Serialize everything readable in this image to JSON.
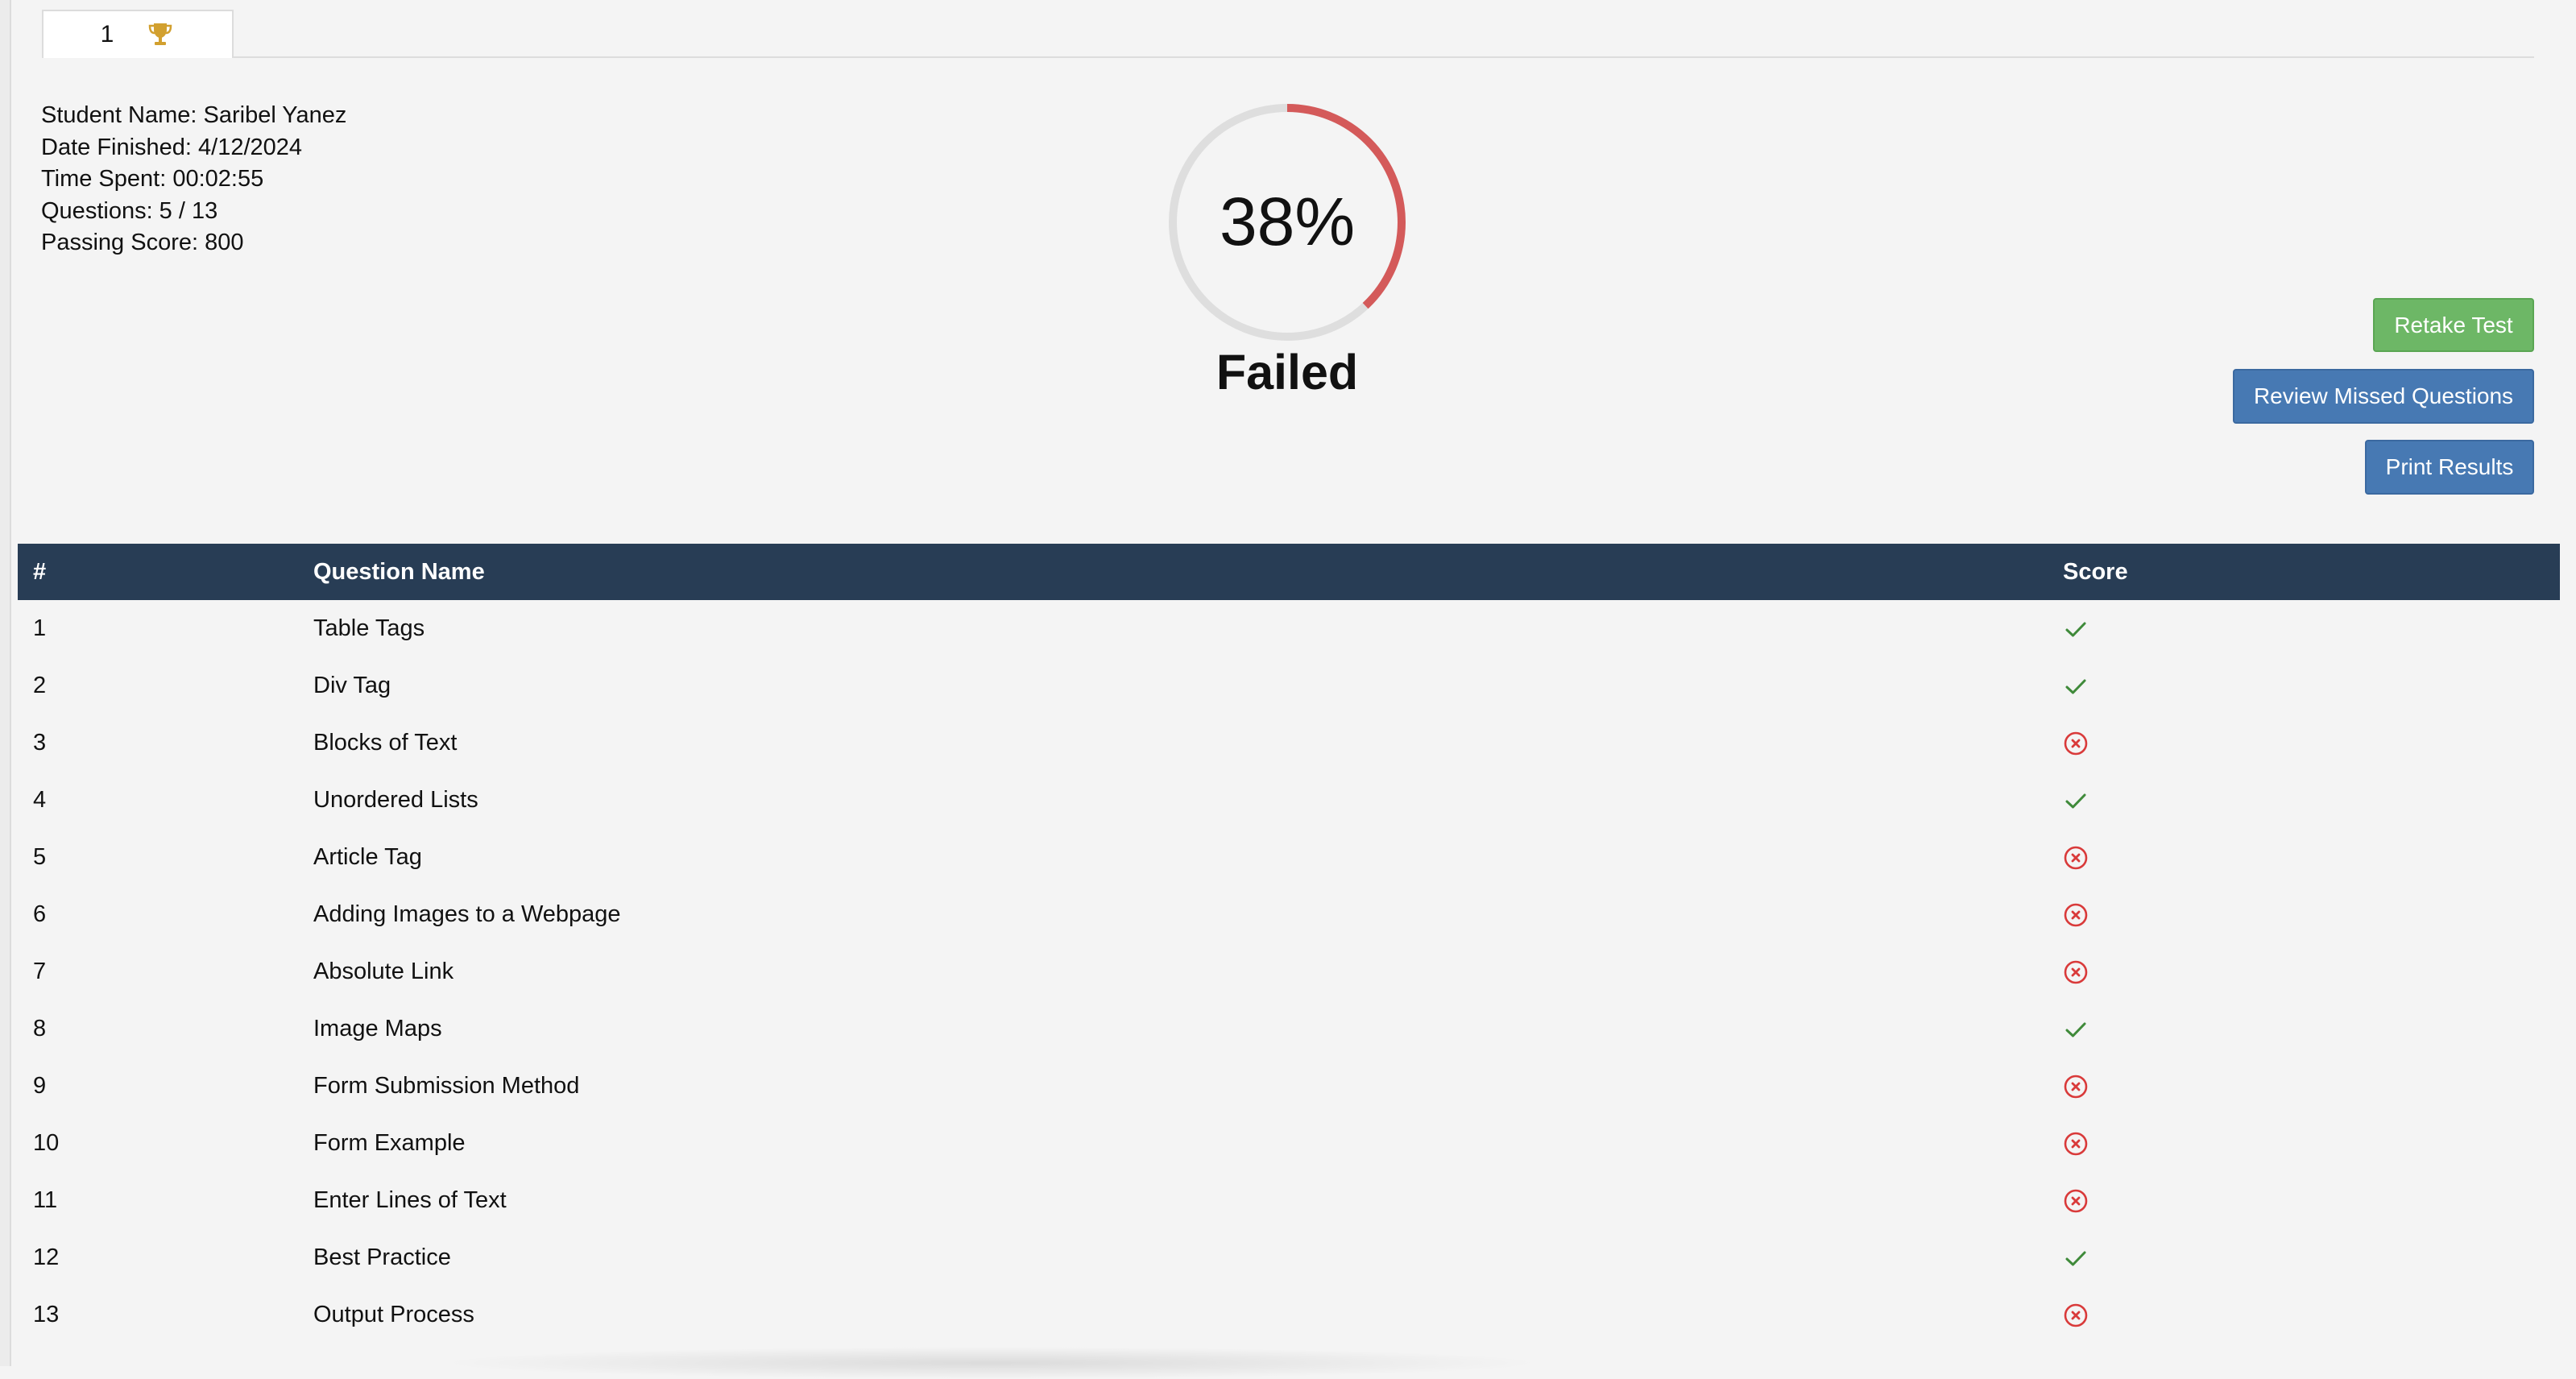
{
  "tab": {
    "label": "1",
    "icon": "trophy-icon",
    "icon_color": "#d2a02f"
  },
  "info": {
    "student_name": "Student Name: Saribel Yanez",
    "date_finished": "Date Finished: 4/12/2024",
    "time_spent": "Time Spent: 00:02:55",
    "questions": "Questions: 5 / 13",
    "passing_score": "Passing Score: 800"
  },
  "result": {
    "percent_label": "38%",
    "percent": 38,
    "status": "Failed",
    "gauge_color": "#d45a5a",
    "track_color": "#dedede"
  },
  "buttons": {
    "retake": "Retake Test",
    "review": "Review Missed Questions",
    "print": "Print Results"
  },
  "table": {
    "headers": {
      "num": "#",
      "name": "Question Name",
      "score": "Score"
    },
    "rows": [
      {
        "num": "1",
        "name": "Table Tags",
        "score": "correct"
      },
      {
        "num": "2",
        "name": "Div Tag",
        "score": "correct"
      },
      {
        "num": "3",
        "name": "Blocks of Text",
        "score": "incorrect"
      },
      {
        "num": "4",
        "name": "Unordered Lists",
        "score": "correct"
      },
      {
        "num": "5",
        "name": "Article Tag",
        "score": "incorrect"
      },
      {
        "num": "6",
        "name": "Adding Images to a Webpage",
        "score": "incorrect"
      },
      {
        "num": "7",
        "name": "Absolute Link",
        "score": "incorrect"
      },
      {
        "num": "8",
        "name": "Image Maps",
        "score": "correct"
      },
      {
        "num": "9",
        "name": "Form Submission Method",
        "score": "incorrect"
      },
      {
        "num": "10",
        "name": "Form Example",
        "score": "incorrect"
      },
      {
        "num": "11",
        "name": "Enter Lines of Text",
        "score": "incorrect"
      },
      {
        "num": "12",
        "name": "Best Practice",
        "score": "correct"
      },
      {
        "num": "13",
        "name": "Output Process",
        "score": "incorrect"
      }
    ]
  },
  "colors": {
    "header_bg": "#283d55",
    "correct": "#3f8a3a",
    "incorrect": "#d93a3a",
    "retake_bg": "#6db766",
    "primary_bg": "#4779b3"
  }
}
